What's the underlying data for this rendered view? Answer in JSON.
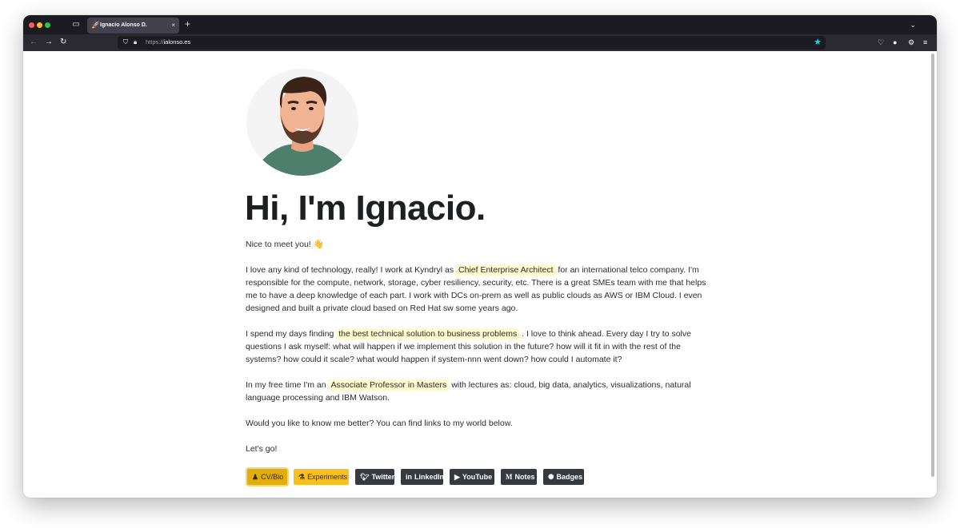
{
  "browser": {
    "tab": {
      "title": "Ignacio Alonso D.",
      "close": "×"
    },
    "new_tab": "+",
    "url": {
      "scheme": "https://",
      "host": "ialonso.es"
    }
  },
  "page": {
    "headline": "Hi, I'm Ignacio.",
    "paragraphs": {
      "p1": "Nice to meet you! 👋",
      "p2_before": "I love any kind of technology, really! I work at Kyndryl as",
      "p2_highlight": "Chief Enterprise Architect",
      "p2_after": "for an international telco company. I'm responsible for the compute, network, storage, cyber resiliency, security, etc. There is a great SMEs team with me that helps me to have a deep knowledge of each part. I work with DCs on-prem as well as public clouds as AWS or IBM Cloud. I even designed and built a private cloud based on Red Hat sw some years ago.",
      "p3_before": "I spend my days finding",
      "p3_highlight": "the best technical solution to business problems",
      "p3_after": ". I love to think ahead. Every day I try to solve questions I ask myself: what will happen if we implement this solution in the future? how will it fit in with the rest of the systems? how could it scale? what would happen if system-nnn went down? how could I automate it?",
      "p4_before": "In my free time I'm an",
      "p4_highlight": "Associate Professor in Masters",
      "p4_after": "with lectures as: cloud, big data, analytics, visualizations, natural language processing and IBM Watson.",
      "p5": "Would you like to know me better? You can find links to my world below.",
      "p6": "Let's go!"
    },
    "buttons": [
      {
        "label": "CV/Bio",
        "icon": "person-icon"
      },
      {
        "label": "Experiments",
        "icon": "flask-icon"
      },
      {
        "label": "Twitter",
        "icon": "twitter-icon"
      },
      {
        "label": "LinkedIn",
        "icon": "linkedin-icon"
      },
      {
        "label": "YouTube",
        "icon": "youtube-icon"
      },
      {
        "label": "Notes",
        "icon": "medium-icon"
      },
      {
        "label": "Badges",
        "icon": "badge-icon"
      }
    ]
  },
  "colors": {
    "highlight": "#fffbcc",
    "button_yellow": "#f5c122",
    "button_dark": "#343a40"
  }
}
